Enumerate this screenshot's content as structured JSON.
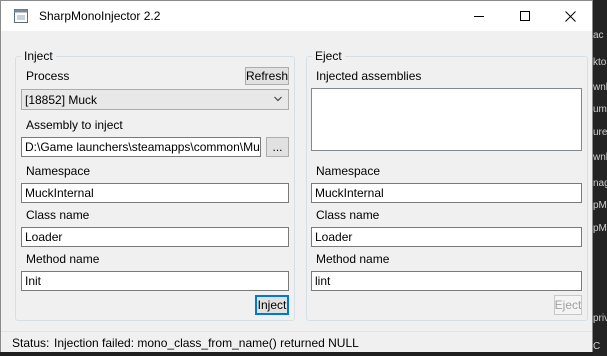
{
  "window": {
    "title": "SharpMonoInjector 2.2"
  },
  "inject": {
    "group_label": "Inject",
    "process_label": "Process",
    "refresh_label": "Refresh",
    "process_value": "[18852] Muck",
    "assembly_label": "Assembly to inject",
    "assembly_path": "D:\\Game launchers\\steamapps\\common\\Mu",
    "browse_label": "...",
    "namespace_label": "Namespace",
    "namespace_value": "MuckInternal",
    "classname_label": "Class name",
    "classname_value": "Loader",
    "method_label": "Method name",
    "method_value": "Init",
    "inject_button": "Inject"
  },
  "eject": {
    "group_label": "Eject",
    "assemblies_label": "Injected assemblies",
    "assemblies": [],
    "namespace_label": "Namespace",
    "namespace_value": "MuckInternal",
    "classname_label": "Class name",
    "classname_value": "Loader",
    "method_label": "Method name",
    "method_value": "lint",
    "eject_button": "Eject"
  },
  "status": {
    "label": "Status:",
    "text": "Injection failed: mono_class_from_name() returned NULL"
  },
  "background": {
    "lines": [
      "ac",
      "kto",
      "wnl",
      "um",
      "ure",
      "wnl",
      "nag",
      "pM",
      "pM",
      "priv",
      "C"
    ]
  },
  "icons": {
    "app": "app-icon",
    "minimize": "minimize-icon",
    "maximize": "maximize-icon",
    "close": "close-icon",
    "dropdown": "chevron-down-icon"
  }
}
